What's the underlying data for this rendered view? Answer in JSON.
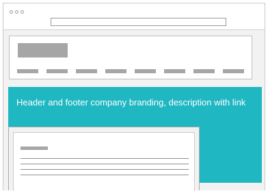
{
  "hero": {
    "text": "Header and footer company branding, description with link"
  },
  "colors": {
    "accent": "#1fb7c2",
    "placeholder_gray": "#a6a6a6",
    "window_bg": "#f2f2f2"
  },
  "icons": {
    "window_controls": [
      "window-dot-icon",
      "window-dot-icon",
      "window-dot-icon"
    ]
  }
}
